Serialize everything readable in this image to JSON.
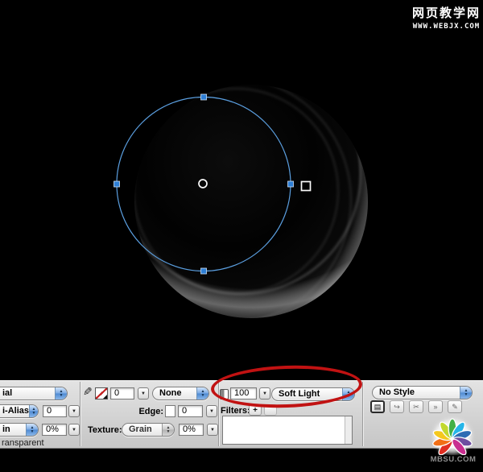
{
  "watermarks": {
    "top": {
      "title": "网页教学网",
      "url": "WWW.WEBJX.COM"
    },
    "bottom": {
      "site": "MBSU.COM"
    }
  },
  "panel": {
    "fill": {
      "type_visible": "ial",
      "antialias_visible": "i-Alias",
      "antialias_value": "0",
      "texture_visible": "in",
      "texture_amount": "0%",
      "transparent_visible": "ransparent"
    },
    "stroke": {
      "tip_size": "0",
      "category": "None",
      "edge_label": "Edge:",
      "edge_value": "0",
      "texture_label": "Texture:",
      "texture_name": "Grain",
      "texture_amount": "0%"
    },
    "effects": {
      "opacity": "100",
      "blend_mode": "Soft Light",
      "filters_label": "Filters:",
      "add_glyph": "+"
    },
    "style": {
      "selected": "No Style",
      "buttons": [
        {
          "name": "new-style-button",
          "glyph": "▤"
        },
        {
          "name": "redefine-style-button",
          "glyph": "↪"
        },
        {
          "name": "detach-style-button",
          "glyph": "✂"
        },
        {
          "name": "expand-style-button",
          "glyph": "»"
        },
        {
          "name": "delete-style-button",
          "glyph": "✎"
        }
      ]
    }
  },
  "icons": {
    "pencil": "✎",
    "dropdown_arrow": "▼",
    "stepper_up": "▲",
    "stepper_down": "▼"
  },
  "colors": {
    "annotation_red": "#c11212",
    "selection_blue": "#5b9fe0",
    "panel_bg": "#d6d6d6",
    "canvas_bg": "#000000"
  }
}
